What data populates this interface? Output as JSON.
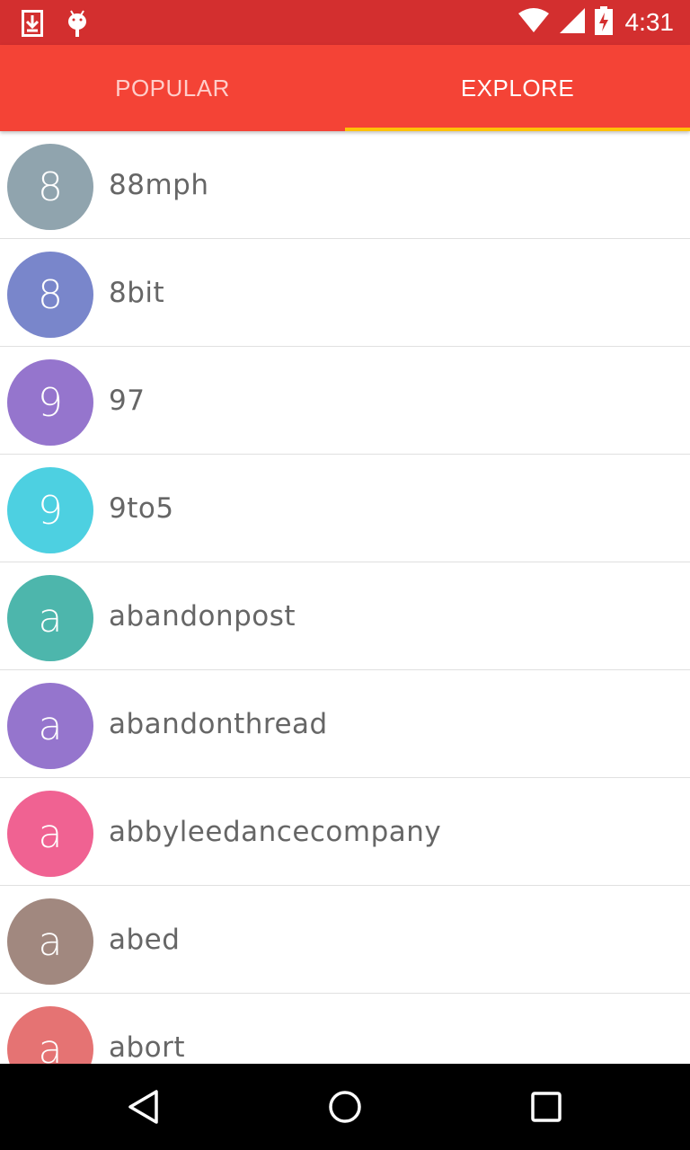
{
  "status_bar": {
    "time": "4:31",
    "icons": [
      "download-icon",
      "android-debug-icon",
      "wifi-icon",
      "signal-icon",
      "battery-charging-icon"
    ]
  },
  "tabs": [
    {
      "label": "POPULAR",
      "selected": false
    },
    {
      "label": "EXPLORE",
      "selected": true
    }
  ],
  "colors": {
    "status_bar": "#d32f2f",
    "tab_bar": "#f44336",
    "indicator": "#ffc107"
  },
  "items": [
    {
      "initial": "8",
      "name": "88mph",
      "color": "#90a4ae"
    },
    {
      "initial": "8",
      "name": "8bit",
      "color": "#7986cb"
    },
    {
      "initial": "9",
      "name": "97",
      "color": "#9575cd"
    },
    {
      "initial": "9",
      "name": "9to5",
      "color": "#4dd0e1"
    },
    {
      "initial": "a",
      "name": "abandonpost",
      "color": "#4db6ac"
    },
    {
      "initial": "a",
      "name": "abandonthread",
      "color": "#9575cd"
    },
    {
      "initial": "a",
      "name": "abbyleedancecompany",
      "color": "#f06292"
    },
    {
      "initial": "a",
      "name": "abed",
      "color": "#a1887f"
    },
    {
      "initial": "a",
      "name": "abort",
      "color": "#e57373"
    }
  ],
  "nav": [
    "back-icon",
    "home-icon",
    "recents-icon"
  ]
}
